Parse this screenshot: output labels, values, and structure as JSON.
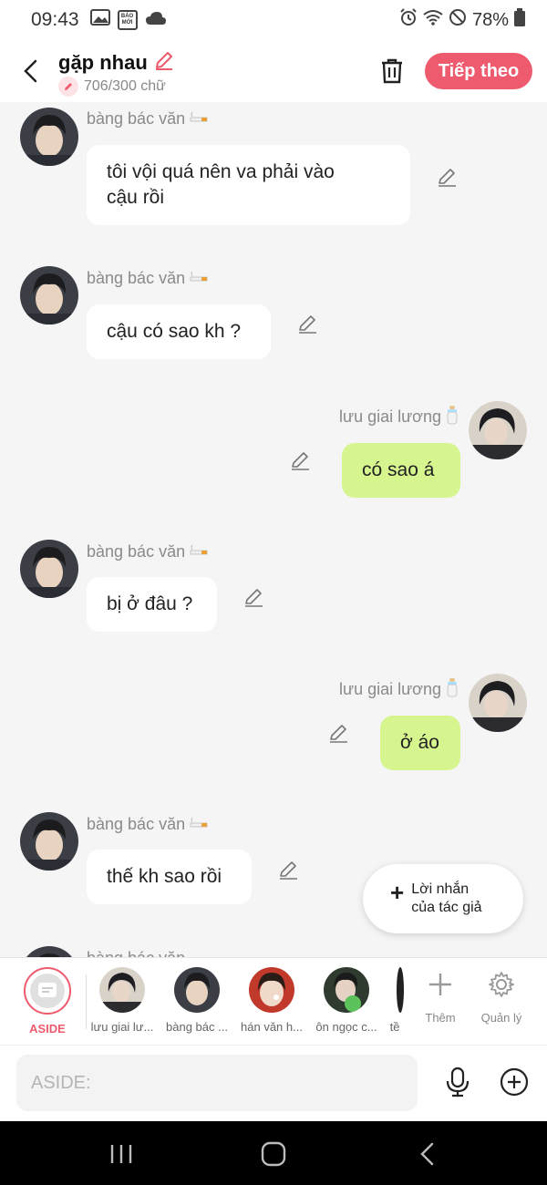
{
  "status_bar": {
    "time": "09:43",
    "news_badge": "BÁO MỚI",
    "battery": "78%"
  },
  "header": {
    "title": "gặp nhau",
    "word_count": "706/300 chữ",
    "next_label": "Tiếp theo"
  },
  "messages": [
    {
      "side": "left",
      "sender": "bàng bác văn",
      "text_lines": [
        "tôi vội quá nên va phải vào",
        "cậu rồi"
      ]
    },
    {
      "side": "left",
      "sender": "bàng bác văn",
      "text": "cậu có sao kh ?"
    },
    {
      "side": "right",
      "sender": "lưu giai lương",
      "text": "có sao á"
    },
    {
      "side": "left",
      "sender": "bàng bác văn",
      "text": "bị ở đâu ?"
    },
    {
      "side": "right",
      "sender": "lưu giai lương",
      "text": "ở áo"
    },
    {
      "side": "left",
      "sender": "bàng bác văn",
      "text": "thế kh sao rồi"
    },
    {
      "side": "left",
      "sender": "bàng bác văn"
    }
  ],
  "fab": {
    "line1": "Lời nhắn",
    "line2": "của tác giả"
  },
  "characters": {
    "aside_label": "ASIDE",
    "items": [
      "lưu giai lư...",
      "bàng bác ...",
      "hán văn h...",
      "ôn ngọc c...",
      "tề"
    ],
    "add_label": "Thêm",
    "manage_label": "Quản lý"
  },
  "input": {
    "placeholder": "ASIDE:"
  },
  "colors": {
    "accent": "#ee5b6f",
    "right_bubble": "#d6f58e",
    "left_bubble": "#ffffff",
    "background": "#f5f5f5"
  }
}
